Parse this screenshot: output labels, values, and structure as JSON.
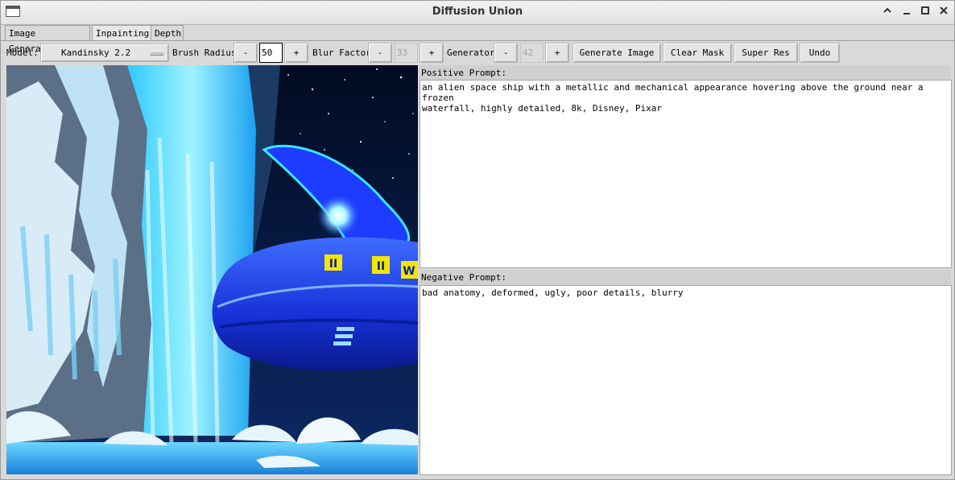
{
  "window": {
    "title": "Diffusion Union"
  },
  "tabs": [
    {
      "label": "Image Generation",
      "active": false
    },
    {
      "label": "Inpainting",
      "active": true
    },
    {
      "label": "Depth",
      "active": false
    }
  ],
  "toolbar": {
    "model_label": "Model:",
    "model_value": "Kandinsky 2.2",
    "brush_radius_label": "Brush Radius",
    "brush_radius_value": "50",
    "blur_factor_label": "Blur Factor",
    "blur_factor_value": "33",
    "generator_label": "Generator",
    "generator_value": "42",
    "minus": "-",
    "plus": "+",
    "generate_label": "Generate Image",
    "clear_mask_label": "Clear Mask",
    "super_res_label": "Super Res",
    "undo_label": "Undo"
  },
  "prompts": {
    "positive_label": "Positive Prompt:",
    "positive_text": "an alien space ship with a metallic and mechanical appearance hovering above the ground near a frozen\nwaterfall, highly detailed, 8k, Disney, Pixar",
    "negative_label": "Negative Prompt:",
    "negative_text": "bad anatomy, deformed, ugly, poor details, blurry"
  },
  "canvas": {
    "ship_markings": [
      "II",
      "II",
      "W"
    ]
  },
  "icons": {
    "app": "window-icon",
    "controls": [
      "chevron-up-icon",
      "minimize-icon",
      "maximize-icon",
      "close-icon"
    ]
  },
  "colors": {
    "sky": "#03102e",
    "ship": "#1a32d8",
    "glow": "#38e6ff",
    "ice": "#cfe9f6"
  }
}
